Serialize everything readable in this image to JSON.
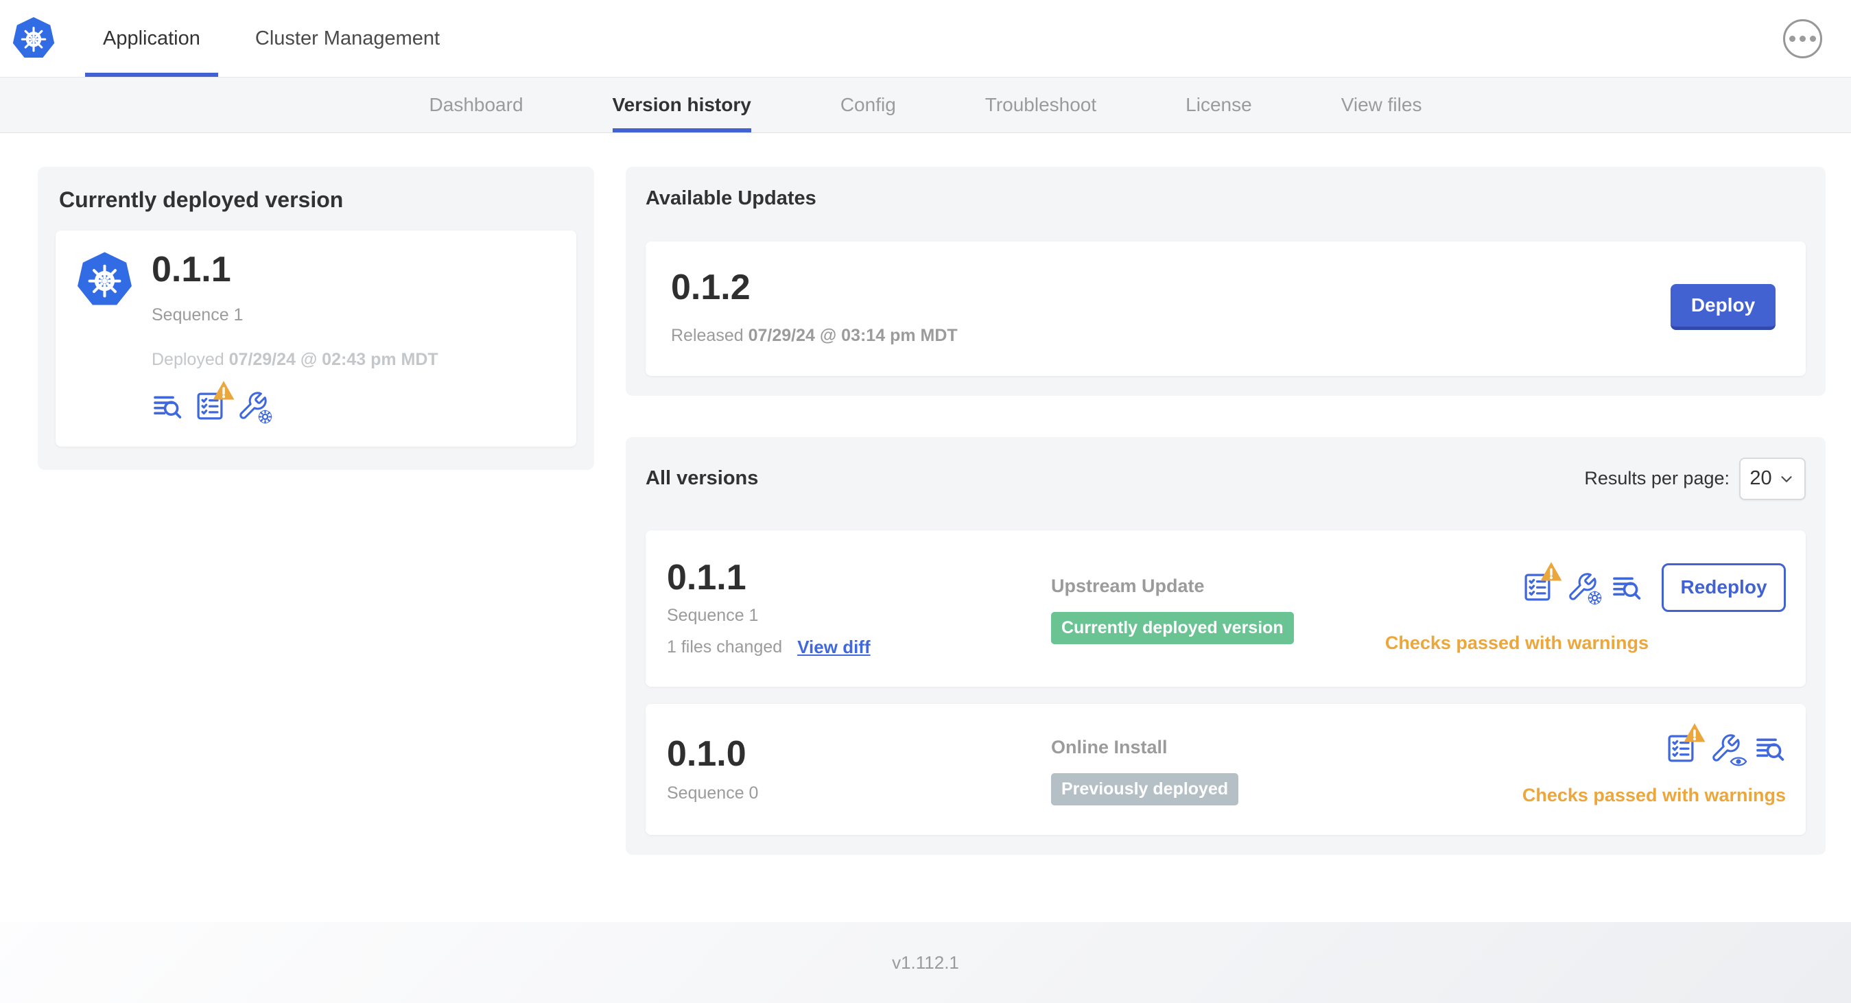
{
  "header": {
    "tabs": [
      {
        "label": "Application"
      },
      {
        "label": "Cluster Management"
      }
    ],
    "more_icon": "ellipsis-icon"
  },
  "subnav": {
    "tabs": [
      {
        "label": "Dashboard"
      },
      {
        "label": "Version history"
      },
      {
        "label": "Config"
      },
      {
        "label": "Troubleshoot"
      },
      {
        "label": "License"
      },
      {
        "label": "View files"
      }
    ]
  },
  "deployed_card": {
    "title": "Currently deployed version",
    "version": "0.1.1",
    "sequence": "Sequence 1",
    "deployed_prefix": "Deployed",
    "deployed_at": "07/29/24 @ 02:43 pm MDT",
    "icons": [
      "log-lines-magnifier-icon",
      "preflight-checklist-warning-icon",
      "wrench-gear-icon"
    ]
  },
  "available_updates": {
    "title": "Available Updates",
    "version": "0.1.2",
    "released_prefix": "Released",
    "released_at": "07/29/24 @ 03:14 pm MDT",
    "deploy_label": "Deploy"
  },
  "all_versions": {
    "title": "All versions",
    "results_per_page_label": "Results per page:",
    "results_per_page_value": "20",
    "rows": [
      {
        "version": "0.1.1",
        "sequence": "Sequence 1",
        "files_changed": "1 files changed",
        "view_diff_label": "View diff",
        "source": "Upstream Update",
        "badge_label": "Currently deployed version",
        "badge_type": "success",
        "status": "Checks passed with warnings",
        "action_label": "Redeploy",
        "icons": [
          "preflight-checklist-warning-icon",
          "wrench-gear-icon",
          "log-lines-magnifier-icon"
        ]
      },
      {
        "version": "0.1.0",
        "sequence": "Sequence 0",
        "source": "Online Install",
        "badge_label": "Previously deployed",
        "badge_type": "muted",
        "status": "Checks passed with warnings",
        "icons": [
          "preflight-checklist-warning-icon",
          "wrench-eye-icon",
          "log-lines-magnifier-icon"
        ]
      }
    ]
  },
  "footer": {
    "version": "v1.112.1"
  },
  "colors": {
    "primary_blue": "#4262d1",
    "icon_blue": "#3f68df",
    "kubernetes_blue": "#326ce5",
    "success_green": "#6ac393",
    "muted_badge_gray": "#b5bfc6",
    "warning_amber": "#eba63c",
    "text_dark": "#323232",
    "text_gray": "#9b9b9b",
    "text_light_gray": "#c4c7ca",
    "card_gray": "#f4f5f7"
  }
}
